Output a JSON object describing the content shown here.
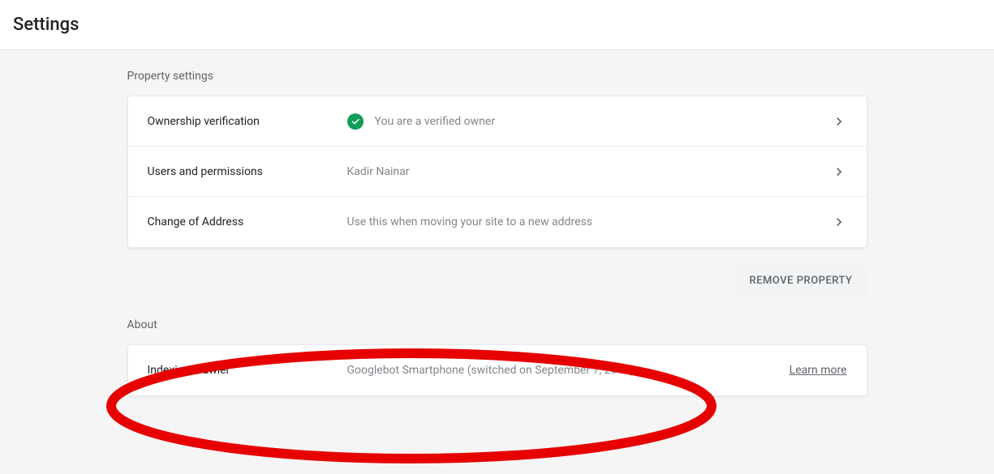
{
  "header": {
    "title": "Settings"
  },
  "sections": {
    "property": {
      "title": "Property settings",
      "rows": {
        "ownership": {
          "label": "Ownership verification",
          "value": "You are a verified owner"
        },
        "users": {
          "label": "Users and permissions",
          "value": "Kadir Nainar"
        },
        "address": {
          "label": "Change of Address",
          "value": "Use this when moving your site to a new address"
        }
      }
    },
    "about": {
      "title": "About",
      "rows": {
        "crawler": {
          "label": "Indexing crawler",
          "value": "Googlebot Smartphone (switched on September 7, 2018)",
          "link": "Learn more"
        }
      }
    }
  },
  "actions": {
    "removeProperty": "REMOVE PROPERTY"
  }
}
